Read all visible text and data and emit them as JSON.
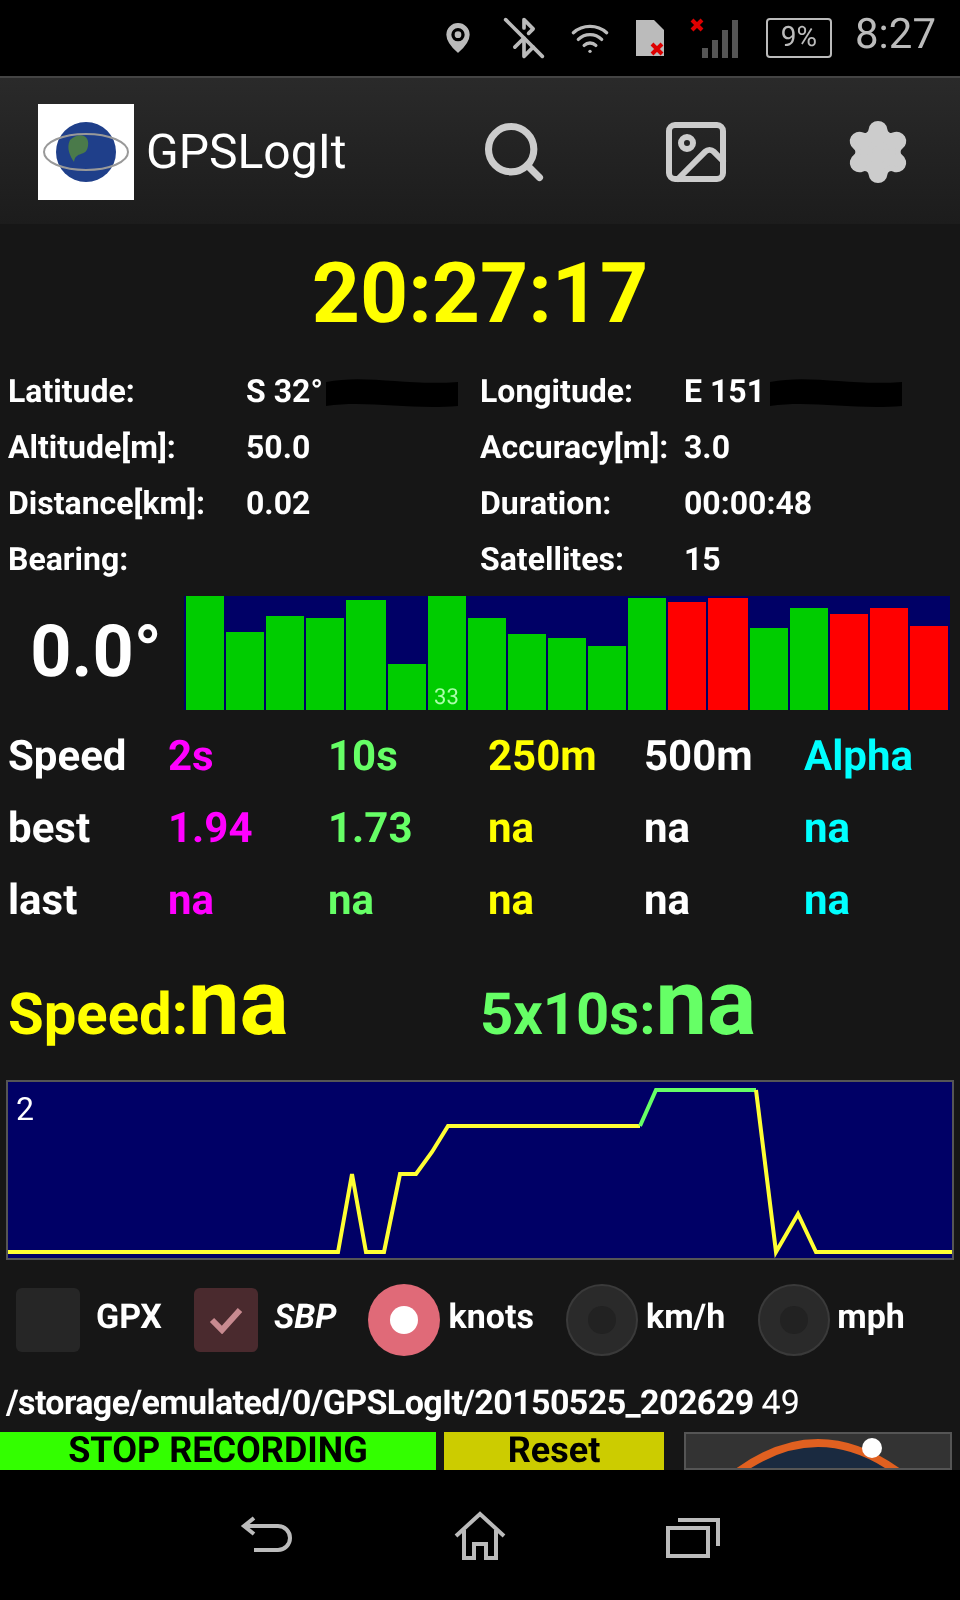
{
  "status_bar": {
    "battery": "9%",
    "time": "8:27"
  },
  "app_bar": {
    "title": "GPSLogIt"
  },
  "clock": "20:27:17",
  "info": [
    {
      "label": "Latitude:",
      "value": "S 32°",
      "redacted": true
    },
    {
      "label": "Longitude:",
      "value": "E 151",
      "redacted": true
    },
    {
      "label": "Altitude[m]:",
      "value": "50.0"
    },
    {
      "label": "Accuracy[m]:",
      "value": "3.0"
    },
    {
      "label": "Distance[km]:",
      "value": "0.02"
    },
    {
      "label": "Duration:",
      "value": "00:00:48"
    },
    {
      "label": "Bearing:"
    },
    {
      "label": "Satellites:",
      "value": "15"
    }
  ],
  "bearing": "0.0°",
  "satellites": [
    {
      "color": "#00cc00"
    },
    {
      "color": "#00cc00"
    },
    {
      "color": "#00cc00"
    },
    {
      "color": "#00cc00"
    },
    {
      "color": "#00cc00"
    },
    {
      "color": "#00cc00"
    },
    {
      "color": "#00cc00",
      "label": "33"
    },
    {
      "color": "#00cc00"
    },
    {
      "color": "#00cc00"
    },
    {
      "color": "#00cc00"
    },
    {
      "color": "#00cc00"
    },
    {
      "color": "#00cc00"
    },
    {
      "color": "#ff0000"
    },
    {
      "color": "#ff0000"
    },
    {
      "color": "#00cc00"
    },
    {
      "color": "#00cc00"
    },
    {
      "color": "#ff0000"
    },
    {
      "color": "#ff0000"
    },
    {
      "color": "#ff0000"
    }
  ],
  "speed_table": {
    "corner": "Speed",
    "columns": [
      {
        "label": "2s",
        "color": "#ff00ff"
      },
      {
        "label": "10s",
        "color": "#66ff66"
      },
      {
        "label": "250m",
        "color": "#ffff00"
      },
      {
        "label": "500m",
        "color": "#ffffff"
      },
      {
        "label": "Alpha",
        "color": "#00ffff"
      }
    ],
    "rows": [
      {
        "label": "best",
        "values": [
          "1.94",
          "1.73",
          "na",
          "na",
          "na"
        ]
      },
      {
        "label": "last",
        "values": [
          "na",
          "na",
          "na",
          "na",
          "na"
        ]
      }
    ]
  },
  "speed_summary": [
    {
      "label": "Speed:",
      "value": "na",
      "color": "#ffff00"
    },
    {
      "label": "5x10s:",
      "value": "na",
      "color": "#66ff66"
    }
  ],
  "graph": {
    "label": "2"
  },
  "options": [
    {
      "kind": "checkbox",
      "label": "GPX",
      "checked": false
    },
    {
      "kind": "checkbox",
      "label": "SBP",
      "checked": true
    },
    {
      "kind": "radio",
      "label": "knots",
      "selected": true
    },
    {
      "kind": "radio",
      "label": "km/h",
      "selected": false
    },
    {
      "kind": "radio",
      "label": "mph",
      "selected": false
    }
  ],
  "file": {
    "path": "/storage/emulated/0/GPSLogIt/20150525_202629",
    "count": "49"
  },
  "buttons": [
    {
      "label": "STOP RECORDING",
      "color": "#33ff00"
    },
    {
      "label": "Reset",
      "color": "#cccc00"
    }
  ]
}
